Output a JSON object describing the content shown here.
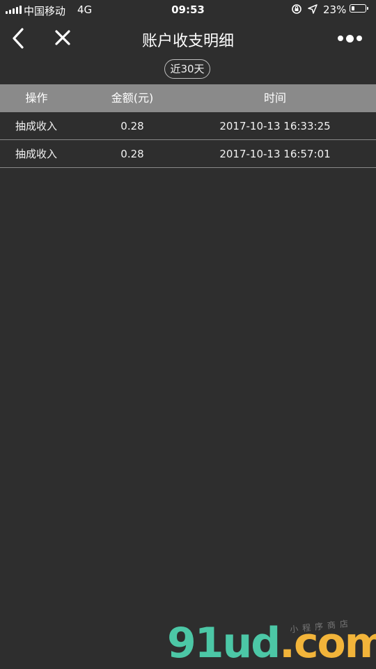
{
  "status_bar": {
    "carrier": "中国移动",
    "network": "4G",
    "time": "09:53",
    "battery_percent_label": "23%",
    "battery_level": 0.23
  },
  "nav": {
    "title": "账户收支明细",
    "icons": [
      "chevron-left-icon",
      "close-icon",
      "more-dots-icon"
    ]
  },
  "filter": {
    "label": "近30天"
  },
  "table": {
    "headers": {
      "operation": "操作",
      "amount": "金额(元)",
      "time": "时间"
    },
    "rows": [
      {
        "operation": "抽成收入",
        "amount": "0.28",
        "time": "2017-10-13 16:33:25"
      },
      {
        "operation": "抽成收入",
        "amount": "0.28",
        "time": "2017-10-13 16:57:01"
      }
    ]
  },
  "watermark": {
    "main": "91ud",
    "dot": ".",
    "suffix": "com",
    "sub": "小程序商店"
  },
  "colors": {
    "background": "#2e2e2e",
    "header_bg": "#8a8a8a",
    "watermark_green": "#4cc7a6",
    "watermark_orange": "#f2b43a"
  }
}
